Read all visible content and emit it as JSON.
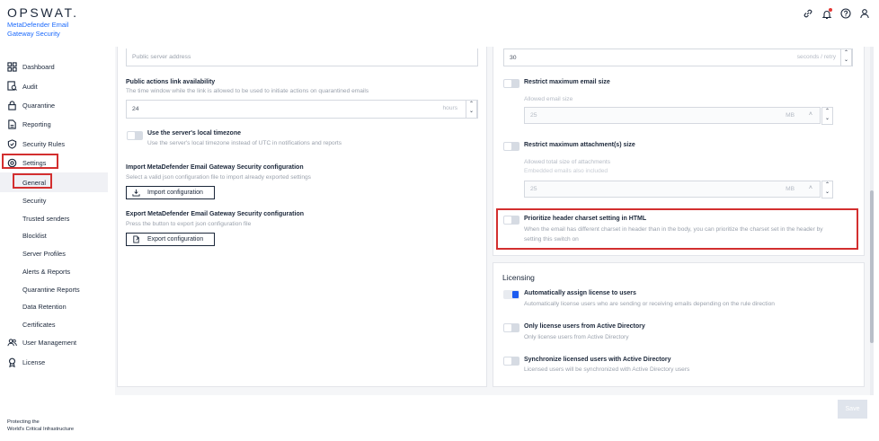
{
  "brand": {
    "logo": "OPSWAT.",
    "product_line1": "MetaDefender Email",
    "product_line2": "Gateway Security",
    "footer_line1": "Protecting the",
    "footer_line2": "World's Critical Infrastructure"
  },
  "topbar": {
    "icons": [
      "link-icon",
      "notification-bell-icon",
      "help-icon",
      "user-icon"
    ],
    "notification_color": "#e53935"
  },
  "sidebar": {
    "items": [
      {
        "label": "Dashboard",
        "icon": "dashboard-icon"
      },
      {
        "label": "Audit",
        "icon": "audit-icon"
      },
      {
        "label": "Quarantine",
        "icon": "lock-icon"
      },
      {
        "label": "Reporting",
        "icon": "report-icon"
      },
      {
        "label": "Security Rules",
        "icon": "shield-icon"
      },
      {
        "label": "Settings",
        "icon": "gear-icon"
      }
    ],
    "settings_children": [
      "General",
      "Security",
      "Trusted senders",
      "Blocklist",
      "Server Profiles",
      "Alerts & Reports",
      "Quarantine Reports",
      "Data Retention",
      "Certificates"
    ],
    "bottom_items": [
      {
        "label": "User Management",
        "icon": "users-icon"
      },
      {
        "label": "License",
        "icon": "license-icon"
      }
    ]
  },
  "left": {
    "public_server_placeholder": "Public server address",
    "links_title": "Public actions link availability",
    "links_desc": "The time window while the link is allowed to be used to initiate actions on quarantined emails",
    "links_value": "24",
    "links_unit": "hours",
    "timezone_title": "Use the server's local timezone",
    "timezone_desc": "Use the server's local timezone instead of UTC in notifications and reports",
    "import_title": "Import MetaDefender Email Gateway Security configuration",
    "import_desc": "Select a valid json configuration file to import already exported settings",
    "import_btn": "Import configuration",
    "export_title": "Export MetaDefender Email Gateway Security configuration",
    "export_desc": "Press the button to export json configuration file",
    "export_btn": "Export configuration"
  },
  "right": {
    "retry_value": "30",
    "retry_unit": "seconds / retry",
    "max_email_title": "Restrict maximum email size",
    "max_email_sub": "Allowed email size",
    "max_email_value": "25",
    "max_email_unit": "MB",
    "max_attach_title": "Restrict maximum attachment(s) size",
    "max_attach_sub1": "Allowed total size of attachments",
    "max_attach_sub2": "Embedded emails also included",
    "max_attach_value": "25",
    "max_attach_unit": "MB",
    "charset_title": "Prioritize header charset setting in HTML",
    "charset_desc1": "When the email has different charset in header than in the body, you can prioritize the charset set in the header by",
    "charset_desc2": "setting this switch on"
  },
  "licensing": {
    "title": "Licensing",
    "auto_title": "Automatically assign license to users",
    "auto_desc": "Automatically license users who are sending or receiving emails depending on the rule direction",
    "ad_title": "Only license users from Active Directory",
    "ad_desc": "Only license users from Active Directory",
    "sync_title": "Synchronize licensed users with Active Directory",
    "sync_desc": "Licensed users will be synchronized with Active Directory users"
  },
  "save_label": "Save",
  "colors": {
    "accent": "#1d5cf0",
    "highlight": "#d32f2f"
  }
}
